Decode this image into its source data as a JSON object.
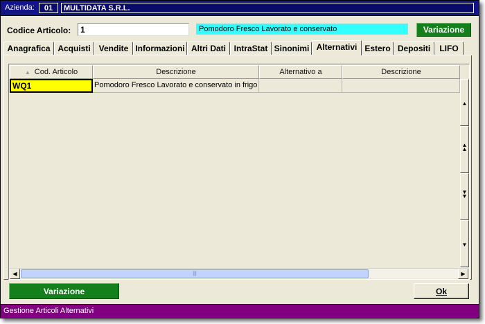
{
  "company": {
    "label": "Azienda:",
    "code": "01",
    "name": "MULTIDATA S.R.L."
  },
  "article": {
    "label": "Codice Articolo:",
    "code_value": "1",
    "description": "Pomodoro Fresco Lavorato e conservato"
  },
  "buttons": {
    "variazione_top": "Variazione",
    "variazione_bottom": "Variazione",
    "ok_label": "Ok"
  },
  "tabs": [
    {
      "label": "Anagrafica"
    },
    {
      "label": "Acquisti"
    },
    {
      "label": "Vendite"
    },
    {
      "label": "Informazioni"
    },
    {
      "label": "Altri Dati"
    },
    {
      "label": "IntraStat"
    },
    {
      "label": "Sinonimi"
    },
    {
      "label": "Alternativi",
      "active": true
    },
    {
      "label": "Estero"
    },
    {
      "label": "Depositi"
    },
    {
      "label": "LIFO"
    }
  ],
  "grid": {
    "columns": [
      "Cod. Articolo",
      "Descrizione",
      "Alternativo a",
      "Descrizione"
    ],
    "rows": [
      [
        "WQ1",
        "Pomodoro Fresco Lavorato e conservato in frigo",
        "",
        ""
      ]
    ]
  },
  "status": {
    "text": "Gestione Articoli Alternativi"
  },
  "colors": {
    "company_bar": "#14148a",
    "accent_green": "#13801b",
    "description_bg": "#33ffff",
    "selected_cell": "#ffff00",
    "status_bar": "#800080"
  },
  "icons": {
    "sort": "sort-asc-icon",
    "scroll_first": "scroll-first-icon",
    "scroll_page_up": "scroll-page-up-icon",
    "scroll_page_down": "scroll-page-down-icon",
    "scroll_last": "scroll-last-icon",
    "scroll_left": "scroll-left-icon",
    "scroll_right": "scroll-right-icon"
  }
}
